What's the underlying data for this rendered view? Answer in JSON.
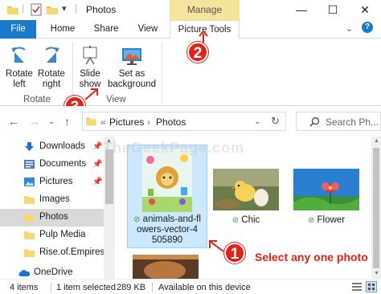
{
  "window": {
    "title": "Photos",
    "contextual_tab_header": "Manage",
    "controls": {
      "minimize": "—",
      "maximize": "☐",
      "close": "✕"
    }
  },
  "ribbon_tabs": [
    "File",
    "Home",
    "Share",
    "View",
    "Picture Tools"
  ],
  "ribbon": {
    "rotate_left": [
      "Rotate",
      "left"
    ],
    "rotate_right": [
      "Rotate",
      "right"
    ],
    "group_rotate": "Rotate",
    "slide_show": [
      "Slide",
      "show"
    ],
    "set_as_background": [
      "Set as",
      "background"
    ],
    "group_view": "View"
  },
  "callouts": [
    "2",
    "3",
    "1"
  ],
  "address_bar": {
    "prefix": "«",
    "crumbs": [
      "Pictures",
      "Photos"
    ],
    "separator": "›"
  },
  "search": {
    "placeholder": "Search Ph..."
  },
  "navigation_pane": [
    {
      "label": "Downloads",
      "icon": "download-arrow-icon",
      "pinned": true
    },
    {
      "label": "Documents",
      "icon": "documents-icon",
      "pinned": true
    },
    {
      "label": "Pictures",
      "icon": "pictures-icon",
      "pinned": true
    },
    {
      "label": "Images",
      "icon": "folder-icon",
      "pinned": false
    },
    {
      "label": "Photos",
      "icon": "folder-icon",
      "pinned": false
    },
    {
      "label": "Pulp Media",
      "icon": "folder-icon",
      "pinned": false
    },
    {
      "label": "Rise.of.Empires.C",
      "icon": "folder-icon",
      "pinned": false
    },
    {
      "label": "OneDrive",
      "icon": "onedrive-icon",
      "pinned": false
    }
  ],
  "files": [
    {
      "name_lines": [
        "animals-and-fl",
        "owers-vector-4",
        "505890"
      ],
      "selected": true,
      "synced": true
    },
    {
      "name_lines": [
        "Chic"
      ],
      "selected": false,
      "synced": true
    },
    {
      "name_lines": [
        "Flower"
      ],
      "selected": false,
      "synced": true
    }
  ],
  "instruction": "Select any one photo",
  "watermark": "TheGeekPage.com",
  "status": {
    "items": "4 items",
    "selection": "1 item selected",
    "size": "289 KB",
    "availability": "Available on this device"
  },
  "colors": {
    "file_tab": "#1979ca",
    "manage_tab": "#f4e59a",
    "selection": "#cce8ff",
    "callout": "#e32119",
    "sync_check": "#2c9a2c"
  }
}
